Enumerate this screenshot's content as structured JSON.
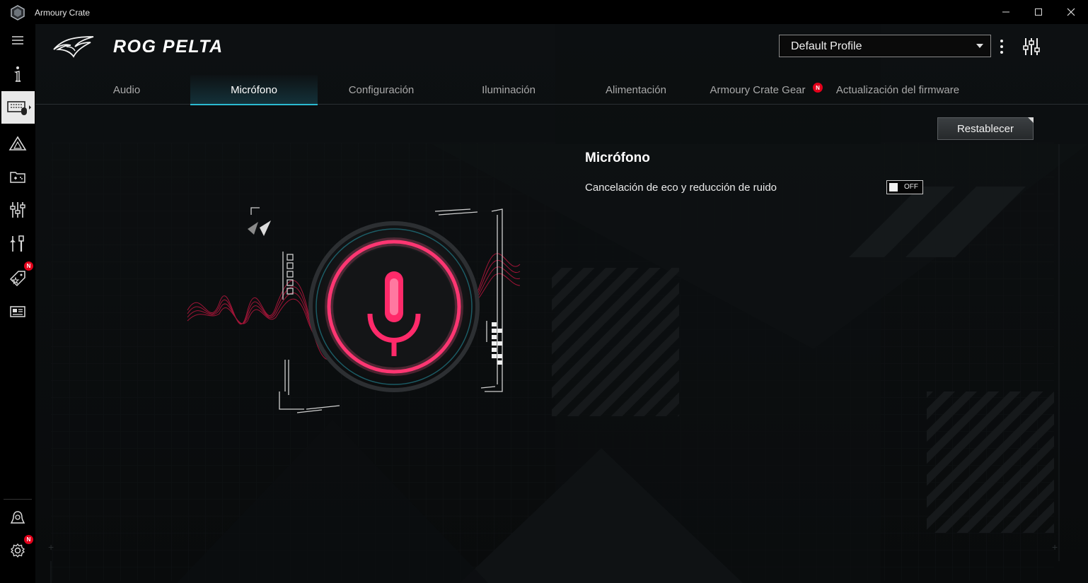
{
  "window": {
    "title": "Armoury Crate",
    "minimize_icon": "minimize-icon",
    "maximize_icon": "maximize-icon",
    "close_icon": "close-icon"
  },
  "sidebar": {
    "items": [
      {
        "icon": "hamburger-menu-icon"
      },
      {
        "icon": "info-icon"
      },
      {
        "icon": "device-keyboard-mouse-icon",
        "active": true
      },
      {
        "icon": "aura-sync-icon"
      },
      {
        "icon": "game-library-icon"
      },
      {
        "icon": "scenario-profiles-icon"
      },
      {
        "icon": "tools-icon"
      },
      {
        "icon": "deals-tag-icon",
        "badge": "N"
      },
      {
        "icon": "news-icon"
      },
      {
        "icon": "user-center-icon"
      },
      {
        "icon": "settings-gear-icon",
        "badge": "N"
      }
    ]
  },
  "header": {
    "device_name": "ROG PELTA",
    "profile": {
      "value": "Default Profile"
    }
  },
  "tabs": [
    {
      "label": "Audio",
      "active": false
    },
    {
      "label": "Micrófono",
      "active": true
    },
    {
      "label": "Configuración",
      "active": false
    },
    {
      "label": "Iluminación",
      "active": false
    },
    {
      "label": "Alimentación",
      "active": false
    },
    {
      "label": "Armoury Crate Gear",
      "active": false,
      "badge": "N"
    },
    {
      "label": "Actualización del firmware",
      "active": false
    }
  ],
  "content": {
    "reset_label": "Restablecer",
    "section_title": "Micrófono",
    "settings": [
      {
        "label": "Cancelación de eco y reducción de ruido",
        "state": "OFF"
      }
    ]
  },
  "colors": {
    "accent_teal": "#2bbad0",
    "rog_red": "#e3001b",
    "mic_pink": "#ff2a6a"
  }
}
